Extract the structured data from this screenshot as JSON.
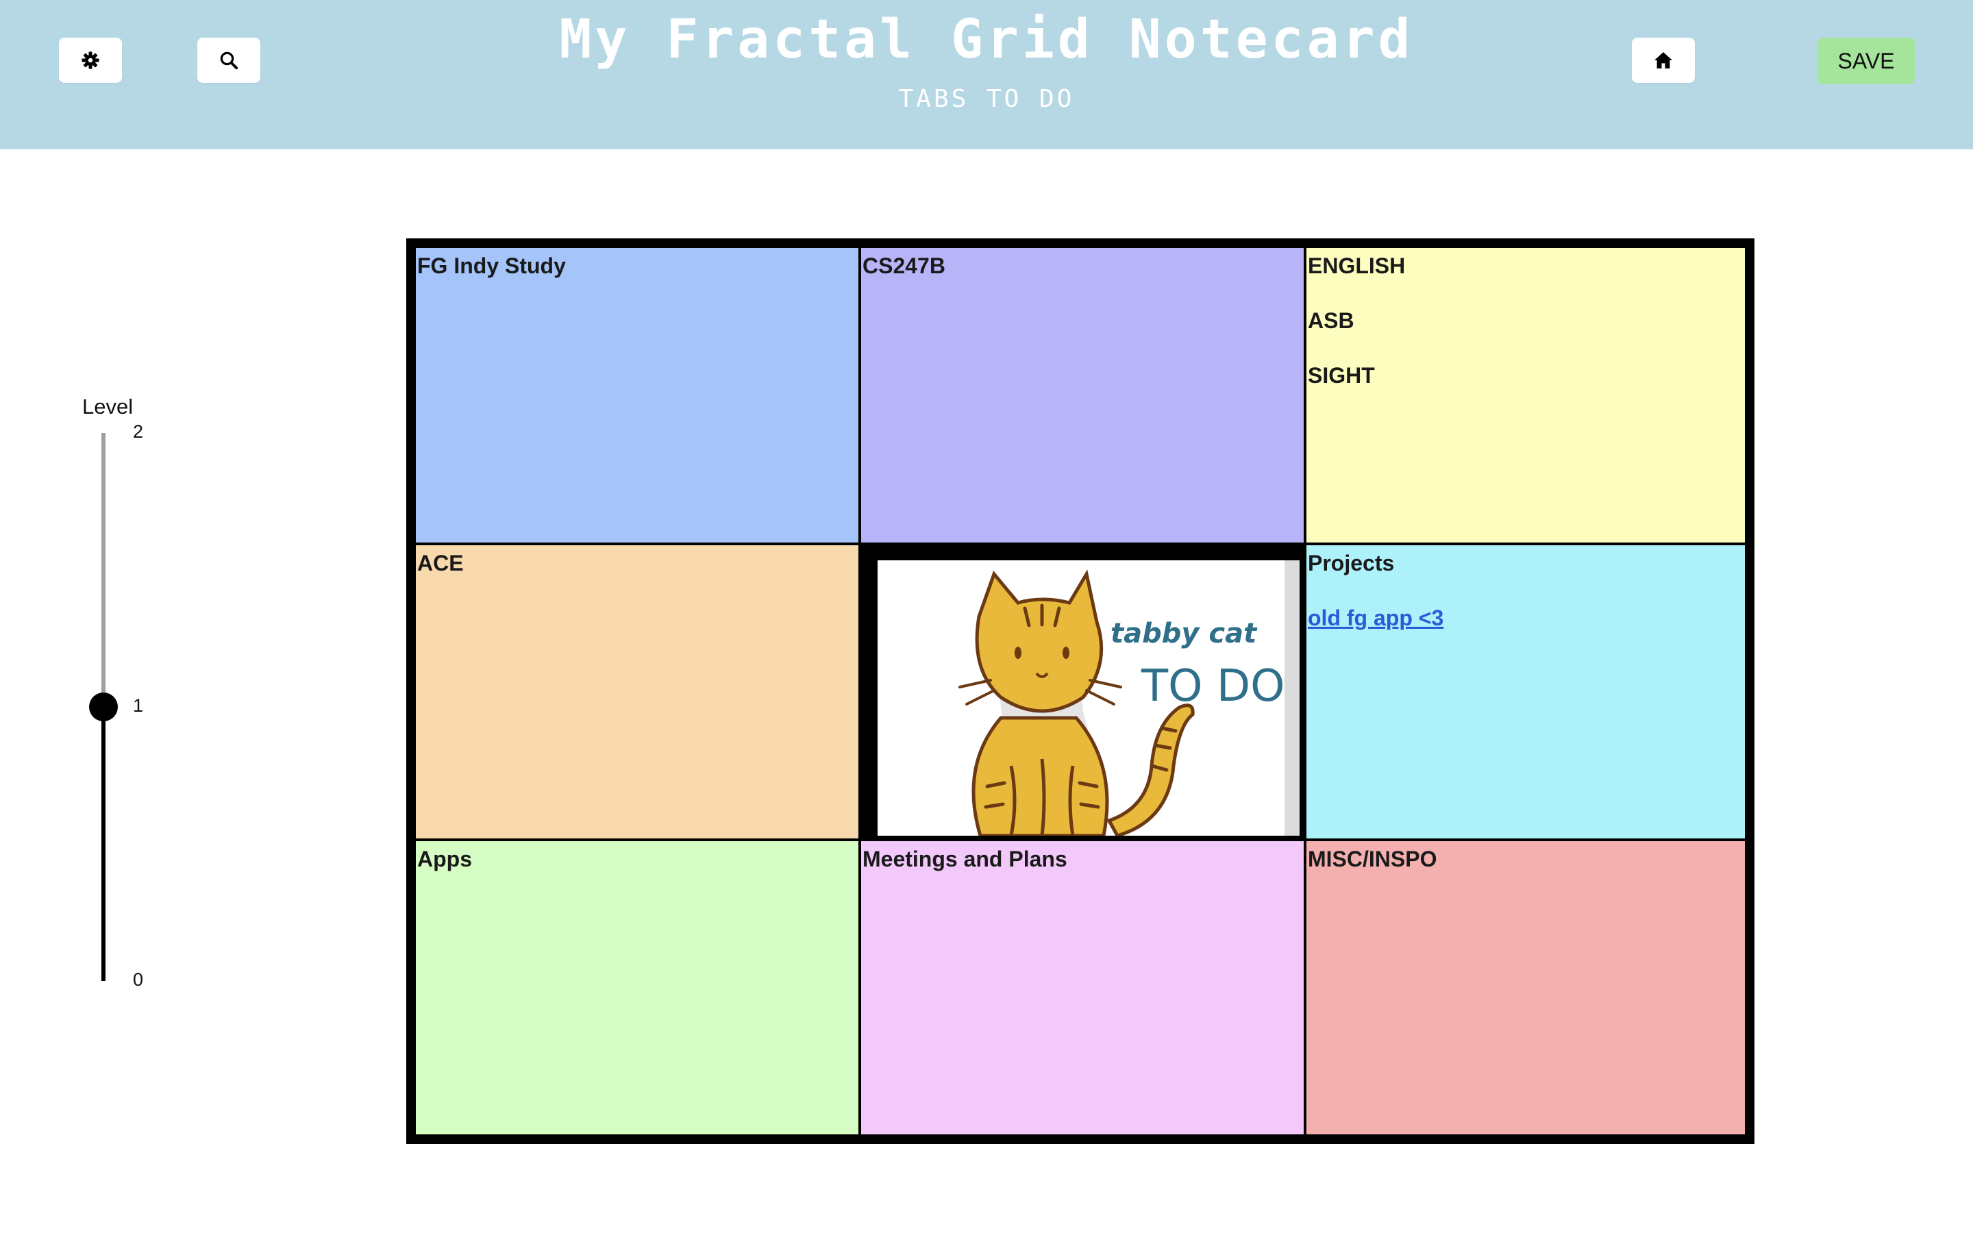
{
  "header": {
    "title": "My Fractal Grid Notecard",
    "subtitle": "TABS TO DO",
    "save_label": "SAVE",
    "background": "#b6d8e4"
  },
  "toolbar_icons": [
    "gear-icon",
    "search-icon",
    "home-icon"
  ],
  "level_slider": {
    "label": "Level",
    "ticks": [
      "2",
      "1",
      "0"
    ],
    "min": 0,
    "max": 2,
    "value": 1
  },
  "grid": {
    "cells": [
      {
        "title": "FG Indy Study",
        "color": "#a5c4fa"
      },
      {
        "title": "CS247B",
        "color": "#b8b4f8"
      },
      {
        "title": "ENGLISH",
        "lines": [
          "ASB",
          "SIGHT"
        ],
        "color": "#fefdc0"
      },
      {
        "title": "ACE",
        "color": "#f8d8ad"
      },
      {
        "image_text": [
          "tabby cat",
          "TO DOs"
        ],
        "color": "#ffffff"
      },
      {
        "title": "Projects",
        "link": "old fg app <3",
        "color": "#adf1fb"
      },
      {
        "title": "Apps",
        "color": "#d5fdc4"
      },
      {
        "title": "Meetings and Plans",
        "color": "#f3c9fb"
      },
      {
        "title": "MISC/INSPO",
        "color": "#f4b0ae"
      }
    ]
  }
}
